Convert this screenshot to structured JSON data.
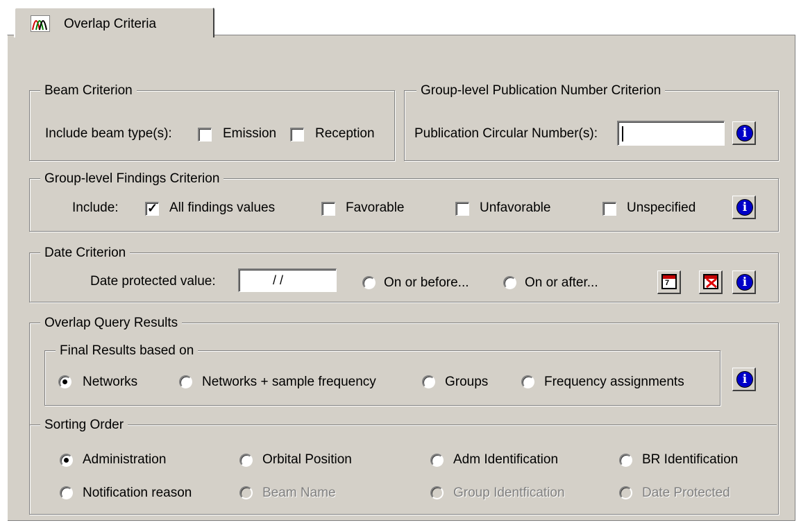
{
  "tab": {
    "title": "Overlap Criteria",
    "icon": "waveform-icon"
  },
  "beam": {
    "legend": "Beam Criterion",
    "include_label": "Include beam type(s):",
    "emission": {
      "label": "Emission",
      "checked": false
    },
    "reception": {
      "label": "Reception",
      "checked": false
    }
  },
  "publication": {
    "legend": "Group-level Publication Number Criterion",
    "label": "Publication Circular Number(s):",
    "value": "",
    "info_icon": "info-icon"
  },
  "findings": {
    "legend": "Group-level Findings Criterion",
    "include_label": "Include:",
    "options": [
      {
        "label": "All findings values",
        "checked": true
      },
      {
        "label": "Favorable",
        "checked": false
      },
      {
        "label": "Unfavorable",
        "checked": false
      },
      {
        "label": "Unspecified",
        "checked": false
      }
    ]
  },
  "date": {
    "legend": "Date Criterion",
    "label": "Date protected value:",
    "value": "/ /",
    "on_or_before": "On or before...",
    "on_or_after": "On or after...",
    "calendar_icon": "calendar-icon",
    "clear_icon": "calendar-clear-icon"
  },
  "results": {
    "legend": "Overlap Query Results",
    "final_legend": "Final Results based on",
    "final_options": [
      {
        "label": "Networks",
        "selected": true
      },
      {
        "label": "Networks + sample frequency",
        "selected": false
      },
      {
        "label": "Groups",
        "selected": false
      },
      {
        "label": "Frequency assignments",
        "selected": false
      }
    ],
    "sorting_legend": "Sorting Order",
    "sorting_options": [
      {
        "label": "Administration",
        "selected": true,
        "enabled": true
      },
      {
        "label": "Orbital Position",
        "selected": false,
        "enabled": true
      },
      {
        "label": "Adm Identification",
        "selected": false,
        "enabled": true
      },
      {
        "label": "BR Identification",
        "selected": false,
        "enabled": true
      },
      {
        "label": "Notification reason",
        "selected": false,
        "enabled": true
      },
      {
        "label": "Beam Name",
        "selected": false,
        "enabled": false
      },
      {
        "label": "Group Identfication",
        "selected": false,
        "enabled": false
      },
      {
        "label": "Date Protected",
        "selected": false,
        "enabled": false
      }
    ]
  },
  "colors": {
    "face": "#d4d0c8",
    "shadow": "#808080",
    "info": "#0000c8"
  }
}
